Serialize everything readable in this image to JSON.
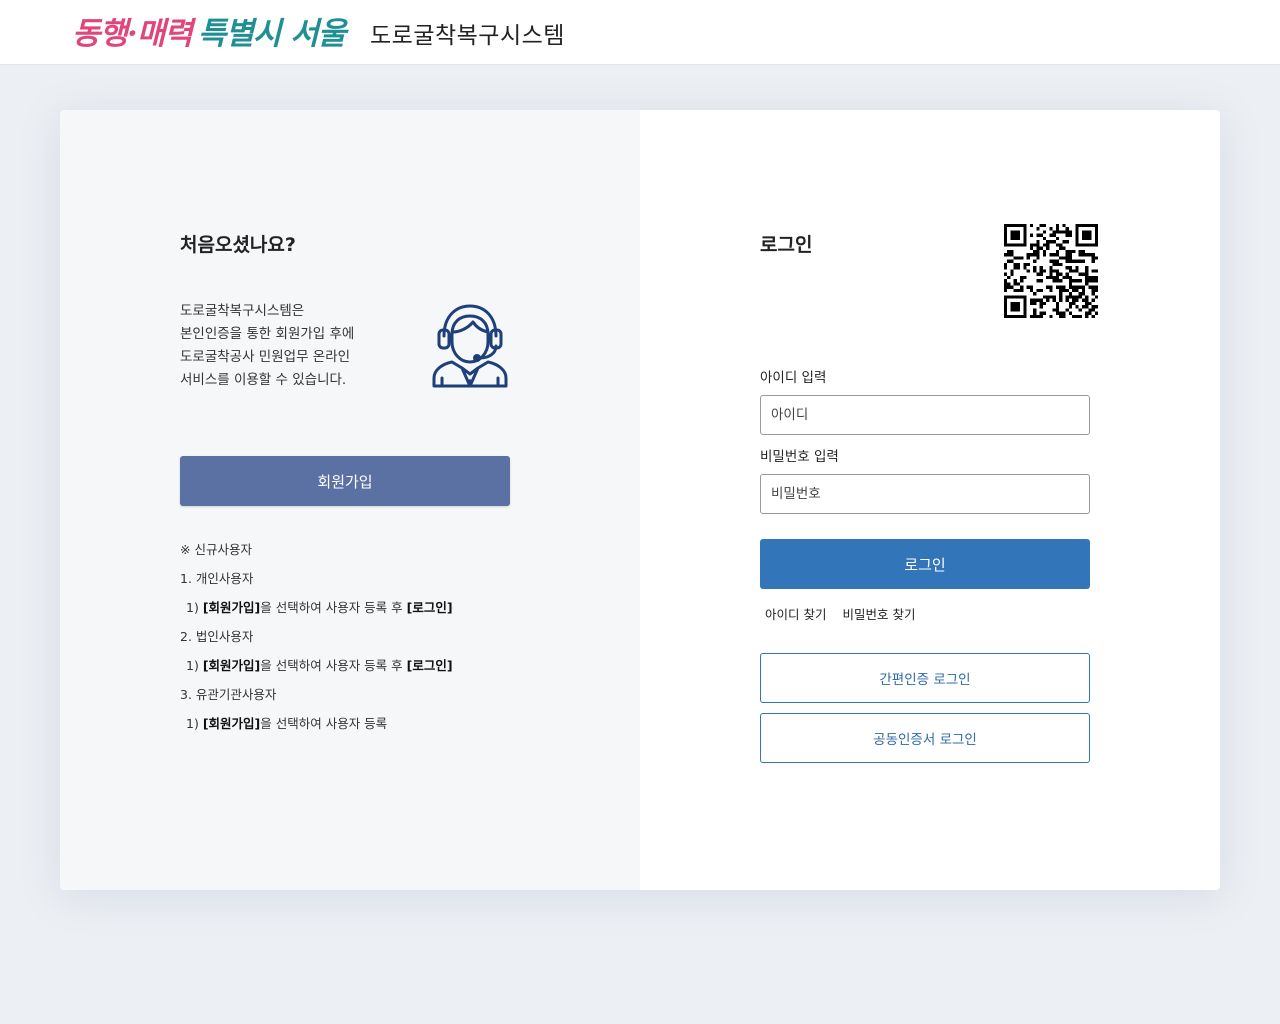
{
  "header": {
    "logo_part1": "동행",
    "logo_dot": "·",
    "logo_part2": "매력",
    "logo_part3": "특별시 서울",
    "system_title": "도로굴착복구시스템"
  },
  "signup_panel": {
    "heading": "처음오셨나요?",
    "description": [
      "도로굴착복구시스템은",
      "본인인증을 통한 회원가입 후에",
      "도로굴착공사 민원업무 온라인",
      "서비스를 이용할 수 있습니다."
    ],
    "signup_button": "회원가입",
    "notes": {
      "title": "※ 신규사용자",
      "individual": "1. 개인사용자",
      "individual_step_pre": "1) ",
      "individual_step_bold": "[회원가입]",
      "individual_step_mid": "을 선택하여 사용자 등록 후 ",
      "individual_step_end": "[로그인]",
      "corporate": "2. 법인사용자",
      "corporate_step_pre": "1) ",
      "corporate_step_bold": "[회원가입]",
      "corporate_step_mid": "을 선택하여 사용자 등록 후 ",
      "corporate_step_end": "[로그인]",
      "agency": "3. 유관기관사용자",
      "agency_step_pre": "1) ",
      "agency_step_bold": "[회원가입]",
      "agency_step_mid": "을 선택하여 사용자 등록"
    }
  },
  "login_panel": {
    "heading": "로그인",
    "id_label": "아이디 입력",
    "id_placeholder": "아이디",
    "pw_label": "비밀번호 입력",
    "pw_placeholder": "비밀번호",
    "login_button": "로그인",
    "find_id": "아이디 찾기",
    "find_pw": "비밀번호 찾기",
    "simple_auth_button": "간편인증 로그인",
    "cert_button": "공동인증서 로그인"
  },
  "colors": {
    "signup_button": "#5c71a3",
    "login_button": "#3275b8",
    "logo_pink": "#e0457b",
    "logo_teal": "#1f8f94",
    "agent_icon": "#1f3f7a"
  },
  "icons": {
    "agent": "customer-service-agent-icon",
    "qr": "qr-code"
  }
}
